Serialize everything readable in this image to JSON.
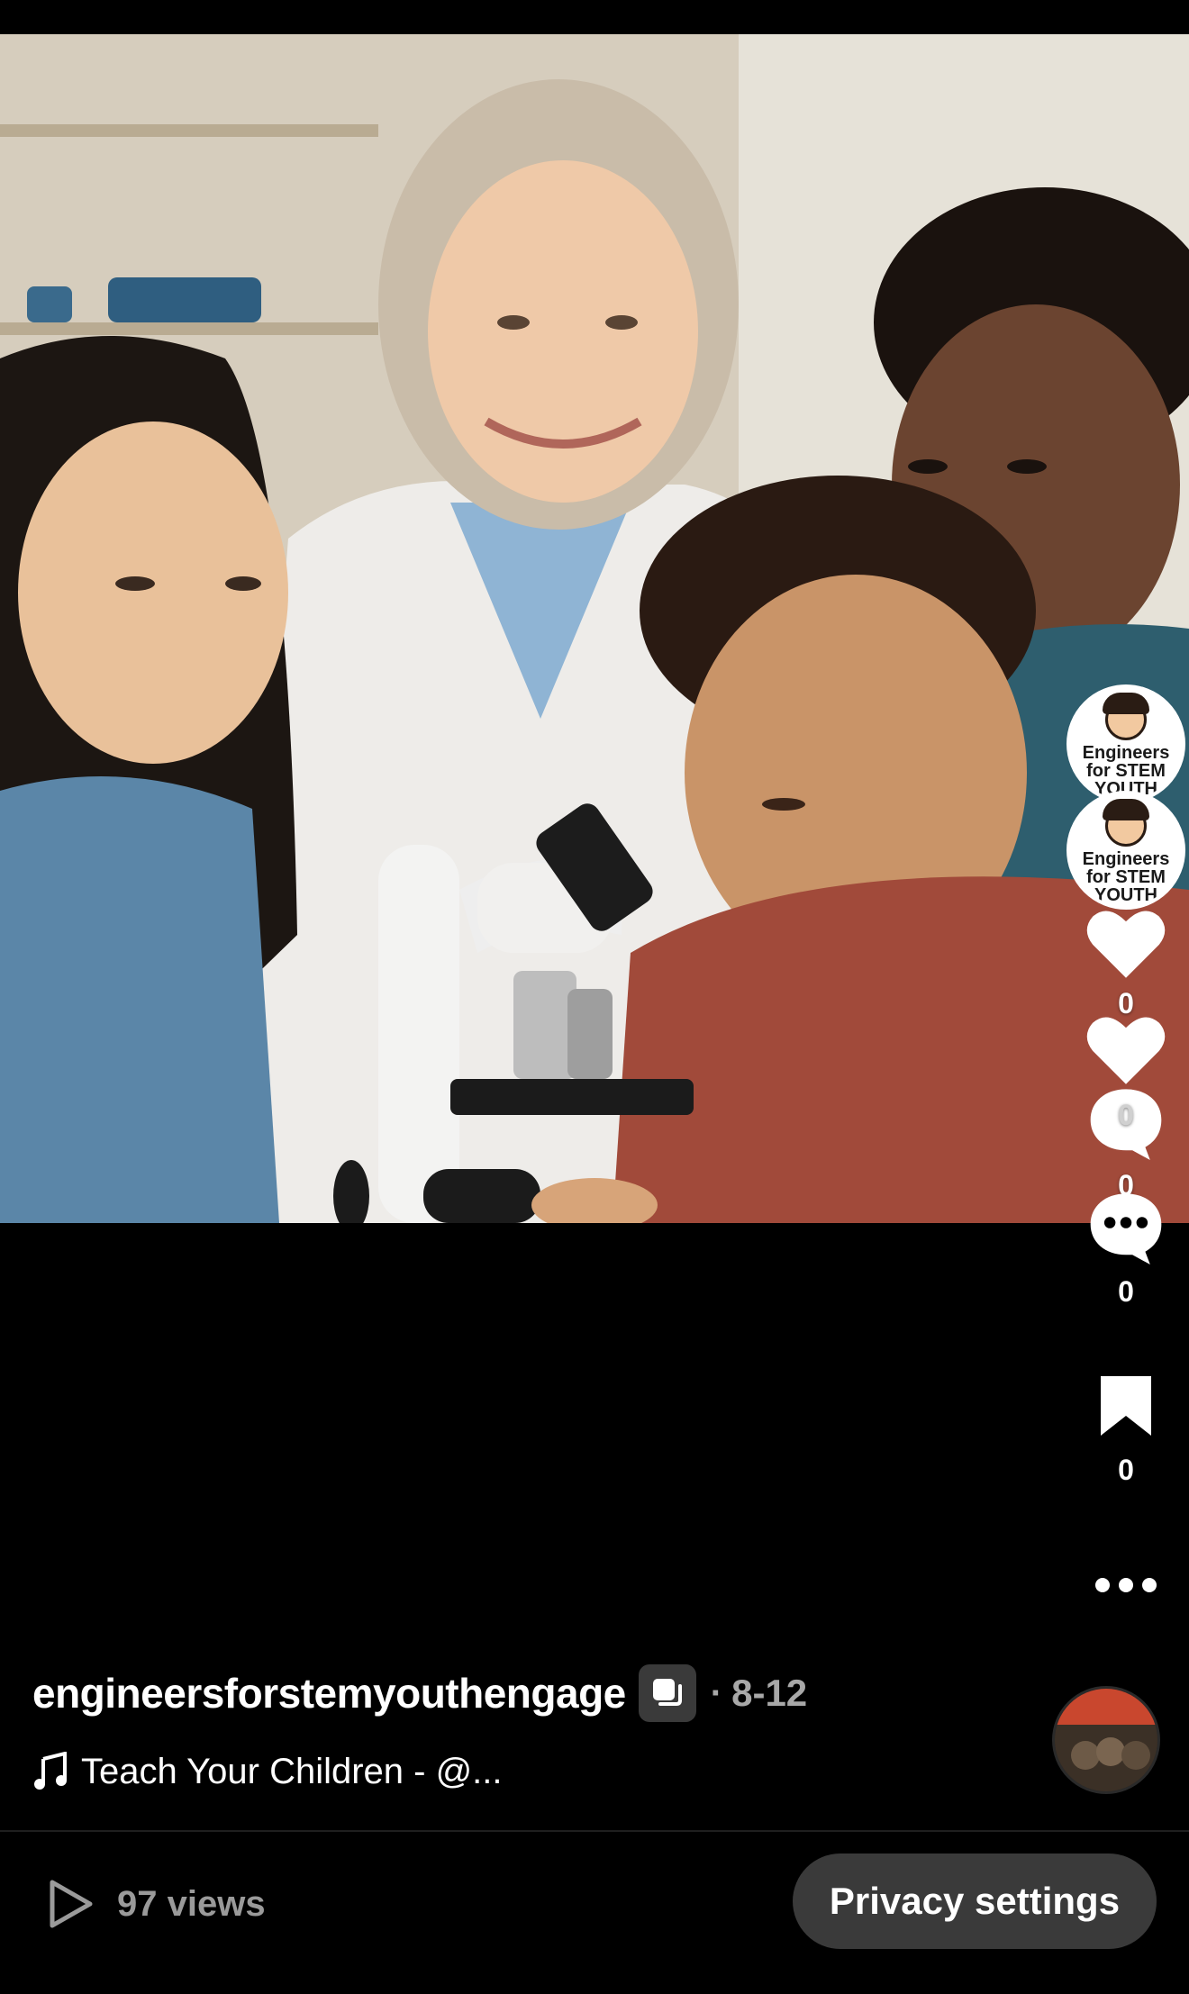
{
  "video": {
    "description_icon": "video-frame"
  },
  "rail": {
    "avatar_label_1": "Engineers for STEM YOUTH",
    "avatar_label_2": "Engineers for STEM YOUTH",
    "like_count_1": "0",
    "like_count_2": "0",
    "comment_count_1": "0",
    "comment_count_2": "0",
    "comment_count_3": "0",
    "save_count": "0",
    "more_icon": "more-horizontal-icon"
  },
  "caption": {
    "username": "engineersforstemyouthengage",
    "separator": "·",
    "date": "8-12",
    "song": "Teach Your Children - @..."
  },
  "footer": {
    "views": "97 views",
    "privacy_button": "Privacy settings"
  },
  "colors": {
    "background": "#000000",
    "button_bg": "#3a3a3a",
    "muted_text": "#a8a8a8"
  }
}
